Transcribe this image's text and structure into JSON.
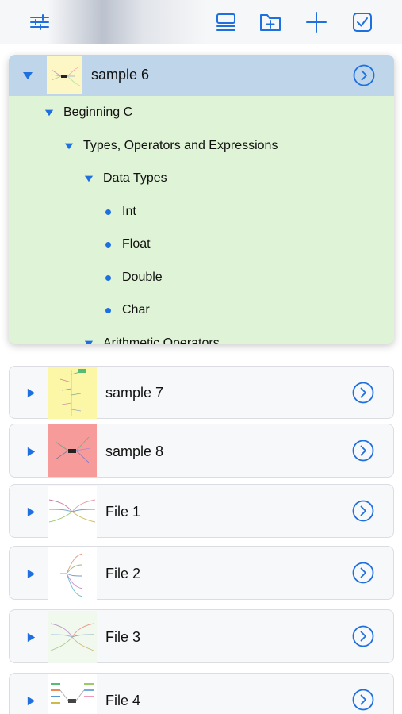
{
  "toolbar": {
    "settings_icon": "sliders-icon",
    "list_icon": "list-layout-icon",
    "new_folder_icon": "folder-plus-icon",
    "add_icon": "plus-icon",
    "select_icon": "checkbox-icon"
  },
  "expanded_file": {
    "name": "sample 6",
    "outline": [
      {
        "text": "Beginning C",
        "level": 1,
        "type": "expanded"
      },
      {
        "text": "Types,  Operators and Expressions",
        "level": 2,
        "type": "expanded"
      },
      {
        "text": "Data Types",
        "level": 3,
        "type": "expanded"
      },
      {
        "text": "Int",
        "level": 4,
        "type": "leaf"
      },
      {
        "text": "Float",
        "level": 4,
        "type": "leaf"
      },
      {
        "text": "Double",
        "level": 4,
        "type": "leaf"
      },
      {
        "text": "Char",
        "level": 4,
        "type": "leaf"
      },
      {
        "text": "Arithmetic Operators",
        "level": 3,
        "type": "expanded"
      }
    ]
  },
  "files": [
    {
      "name": "sample 7",
      "thumb_color": "#fbf7a6"
    },
    {
      "name": "sample 8",
      "thumb_color": "#f79a9a"
    },
    {
      "name": "File 1",
      "thumb_color": "#ffffff"
    },
    {
      "name": "File 2",
      "thumb_color": "#ffffff"
    },
    {
      "name": "File 3",
      "thumb_color": "#f1f8ee"
    },
    {
      "name": "File 4",
      "thumb_color": "#ffffff"
    }
  ],
  "colors": {
    "accent": "#1e6fe0",
    "selected_header": "#bed5ea",
    "outline_bg": "#dff3d6",
    "card_bg": "#f7f8fa"
  }
}
